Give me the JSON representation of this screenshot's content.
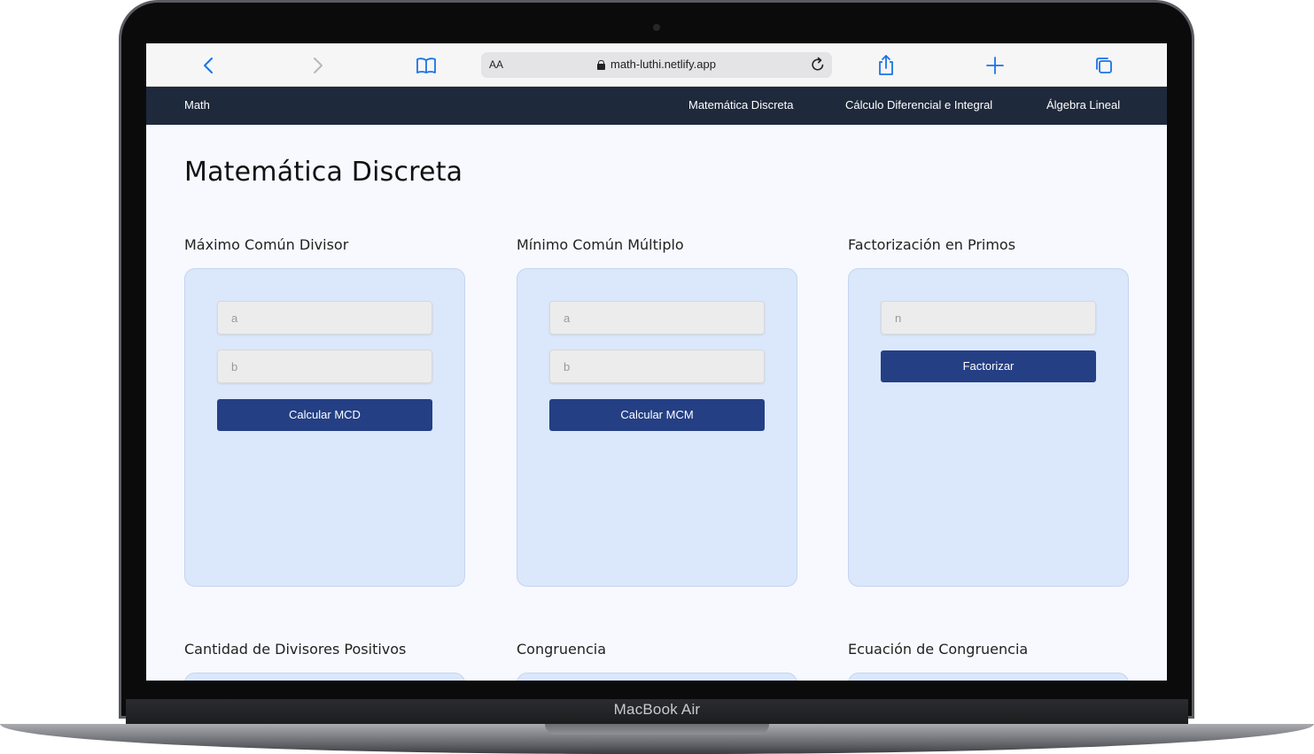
{
  "device": {
    "model_label": "MacBook Air"
  },
  "browser": {
    "text_size_button": "AA",
    "url": "math-luthi.netlify.app",
    "icons": [
      "back-icon",
      "forward-icon",
      "bookmarks-icon",
      "lock-icon",
      "reload-icon",
      "share-icon",
      "new-tab-icon",
      "tabs-icon"
    ]
  },
  "nav": {
    "brand": "Math",
    "links": [
      "Matemática Discreta",
      "Cálculo Diferencial e Integral",
      "Álgebra Lineal"
    ]
  },
  "main": {
    "title": "Matemática Discreta",
    "sections": [
      {
        "title": "Máximo Común Divisor",
        "inputs": [
          "a",
          "b"
        ],
        "button": "Calcular MCD"
      },
      {
        "title": "Mínimo Común Múltiplo",
        "inputs": [
          "a",
          "b"
        ],
        "button": "Calcular MCM"
      },
      {
        "title": "Factorización en Primos",
        "inputs": [
          "n"
        ],
        "button": "Factorizar"
      },
      {
        "title": "Cantidad de Divisores Positivos"
      },
      {
        "title": "Congruencia"
      },
      {
        "title": "Ecuación de Congruencia"
      }
    ]
  },
  "colors": {
    "navbar": "#1e293b",
    "page_background": "#f7f9fe",
    "card_background": "#dbe7fb",
    "button": "#243f84",
    "safari_accent": "#1a73e8"
  }
}
